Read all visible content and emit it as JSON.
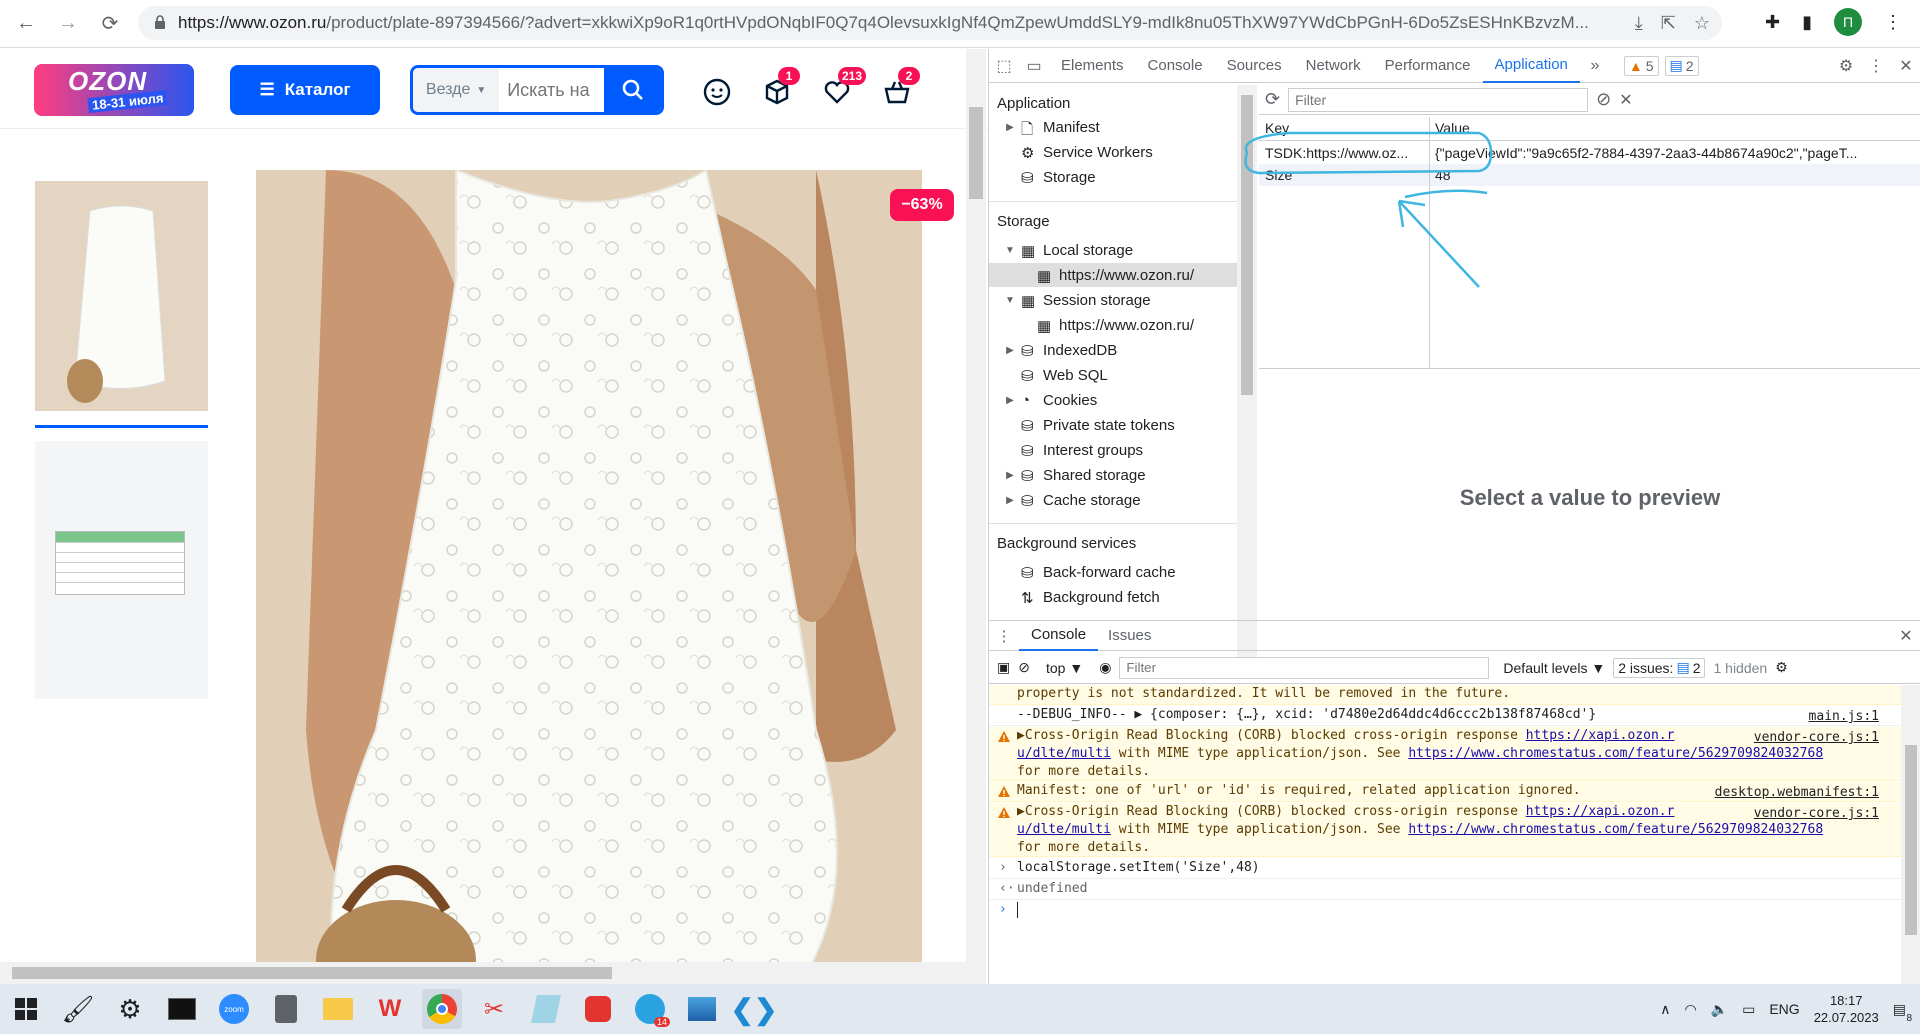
{
  "browser": {
    "url_host": "https://www.ozon.ru",
    "url_path": "/product/plate-897394566/?advert=xkkwiXp9oR1q0rtHVpdONqbIF0Q7q4OlevsuxkIgNf4QmZpewUmddSLY9-mdIk8nu05ThXW97YWdCbPGnH-6Do5ZsESHnKBzvzM...",
    "profile_initial": "П"
  },
  "ozon": {
    "logo_text": "OZON",
    "logo_dates": "18-31 июля",
    "catalog_label": "Каталог",
    "search_scope": "Везде",
    "search_placeholder": "Искать на",
    "badges": {
      "orders": "1",
      "favorites": "213",
      "cart": "2"
    },
    "discount": "−63%"
  },
  "devtools": {
    "tabs": [
      "Elements",
      "Console",
      "Sources",
      "Network",
      "Performance",
      "Application"
    ],
    "active_tab": "Application",
    "warnings_count": "5",
    "messages_count": "2",
    "sidebar": {
      "application_title": "Application",
      "application_items": [
        "Manifest",
        "Service Workers",
        "Storage"
      ],
      "storage_title": "Storage",
      "storage_items": {
        "local_storage": "Local storage",
        "local_origin": "https://www.ozon.ru/",
        "session_storage": "Session storage",
        "session_origin": "https://www.ozon.ru/",
        "indexeddb": "IndexedDB",
        "websql": "Web SQL",
        "cookies": "Cookies",
        "private_state": "Private state tokens",
        "interest": "Interest groups",
        "shared": "Shared storage",
        "cache": "Cache storage"
      },
      "bg_title": "Background services",
      "bg_items": [
        "Back-forward cache",
        "Background fetch"
      ]
    },
    "storage_table": {
      "filter_placeholder": "Filter",
      "headers": {
        "key": "Key",
        "value": "Value"
      },
      "rows": [
        {
          "key": "TSDK:https://www.oz...",
          "value": "{\"pageViewId\":\"9a9c65f2-7884-4397-2aa3-44b8674a90c2\",\"pageT..."
        },
        {
          "key": "Size",
          "value": "48"
        }
      ],
      "preview_message": "Select a value to preview"
    },
    "console": {
      "tabs": [
        "Console",
        "Issues"
      ],
      "context": "top",
      "filter_placeholder": "Filter",
      "levels": "Default levels",
      "issues_label": "2 issues:",
      "issues_count": "2",
      "hidden": "1 hidden",
      "messages": [
        {
          "type": "warn",
          "text": "property is not standardized. It will be removed in the future."
        },
        {
          "type": "info",
          "text": "--DEBUG_INFO--  ▶ {composer: {…}, xcid: 'd7480e2d64ddc4d6ccc2b138f87468cd'}",
          "source": "main.js:1"
        },
        {
          "type": "warn",
          "text": "▶Cross-Origin Read Blocking (CORB) blocked cross-origin response",
          "link": "https://xapi.ozon.r",
          "line2_a": "u/dlte/multi",
          "line2_b": " with MIME type application/json. See ",
          "see_link": "https://www.chromestatus.com/feature/5629709824032768",
          "line3": "for more details.",
          "source": "vendor-core.js:1"
        },
        {
          "type": "warn",
          "text": "Manifest: one of 'url' or 'id' is required, related application ignored.",
          "source": "desktop.webmanifest:1"
        },
        {
          "type": "warn",
          "text": "▶Cross-Origin Read Blocking (CORB) blocked cross-origin response",
          "link": "https://xapi.ozon.r",
          "line2_a": "u/dlte/multi",
          "line2_b": " with MIME type application/json. See ",
          "see_link": "https://www.chromestatus.com/feature/5629709824032768",
          "line3": "for more details.",
          "source": "vendor-core.js:1"
        }
      ],
      "command": "localStorage.setItem('Size',48)",
      "result": "undefined"
    }
  },
  "taskbar": {
    "lang": "ENG",
    "time": "18:17",
    "date": "22.07.2023",
    "notif_count": "8",
    "telegram_badge": "14"
  },
  "colors": {
    "ozon_blue": "#005bff",
    "ozon_pink": "#f91155",
    "annotation": "#3fb6e0",
    "devtools_blue": "#1a73e8"
  }
}
